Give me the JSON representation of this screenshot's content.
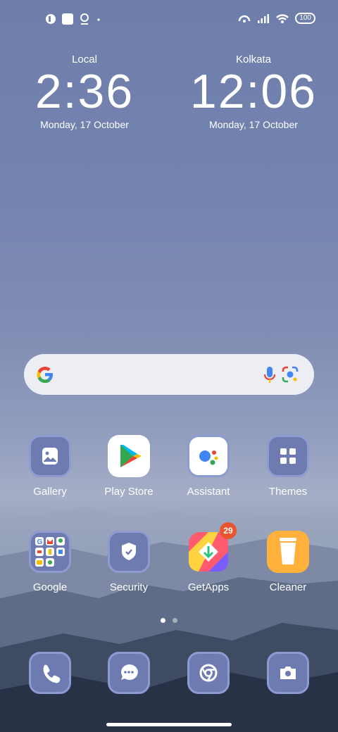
{
  "status_bar": {
    "battery": "100"
  },
  "clocks": [
    {
      "city": "Local",
      "time": "2:36",
      "date": "Monday, 17 October"
    },
    {
      "city": "Kolkata",
      "time": "12:06",
      "date": "Monday, 17 October"
    }
  ],
  "search": {
    "logo": "G"
  },
  "apps": [
    {
      "label": "Gallery",
      "icon": "gallery-icon"
    },
    {
      "label": "Play Store",
      "icon": "play-store-icon"
    },
    {
      "label": "Assistant",
      "icon": "assistant-icon"
    },
    {
      "label": "Themes",
      "icon": "themes-icon"
    },
    {
      "label": "Google",
      "icon": "google-folder-icon"
    },
    {
      "label": "Security",
      "icon": "security-icon"
    },
    {
      "label": "GetApps",
      "icon": "getapps-icon",
      "badge": "29"
    },
    {
      "label": "Cleaner",
      "icon": "cleaner-icon"
    }
  ],
  "dock": [
    {
      "icon": "phone-icon"
    },
    {
      "icon": "messages-icon"
    },
    {
      "icon": "chrome-icon"
    },
    {
      "icon": "camera-icon"
    }
  ],
  "page_indicator": {
    "pages": 2,
    "active": 1
  }
}
